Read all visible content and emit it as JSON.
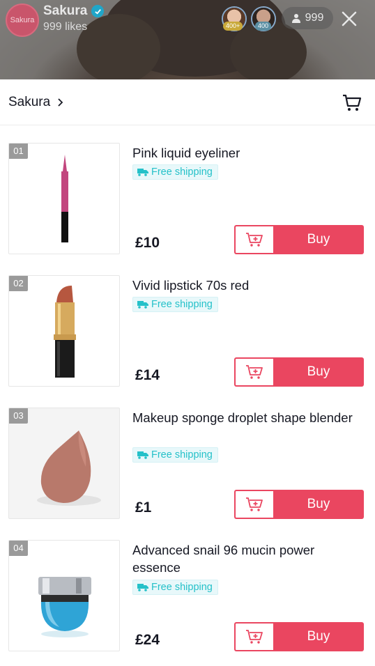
{
  "live": {
    "host_avatar_text": "Sakura",
    "host_name": "Sakura",
    "host_likes": "999 likes",
    "viewers": [
      {
        "badge": "400+",
        "badge_color": "#c9a93a"
      },
      {
        "badge": "400",
        "badge_color": "#5b8fa3"
      }
    ],
    "viewer_count": "999",
    "close_icon": "close-icon"
  },
  "shop": {
    "name": "Sakura",
    "cart_icon": "shopping-cart-icon"
  },
  "products": [
    {
      "rank": "01",
      "title": "Pink liquid eyeliner",
      "shipping": "Free shipping",
      "price": "£10",
      "buy": "Buy"
    },
    {
      "rank": "02",
      "title": "Vivid lipstick 70s red",
      "shipping": "Free shipping",
      "price": "£14",
      "buy": "Buy"
    },
    {
      "rank": "03",
      "title": "Makeup sponge droplet shape blender",
      "shipping": "Free shipping",
      "price": "£1",
      "buy": "Buy"
    },
    {
      "rank": "04",
      "title": "Advanced snail 96 mucin power essence",
      "shipping": "Free shipping",
      "price": "£24",
      "buy": "Buy"
    }
  ],
  "colors": {
    "accent": "#ea4660",
    "shipping_text": "#25c1c9",
    "shipping_bg": "#e8f8fa"
  }
}
